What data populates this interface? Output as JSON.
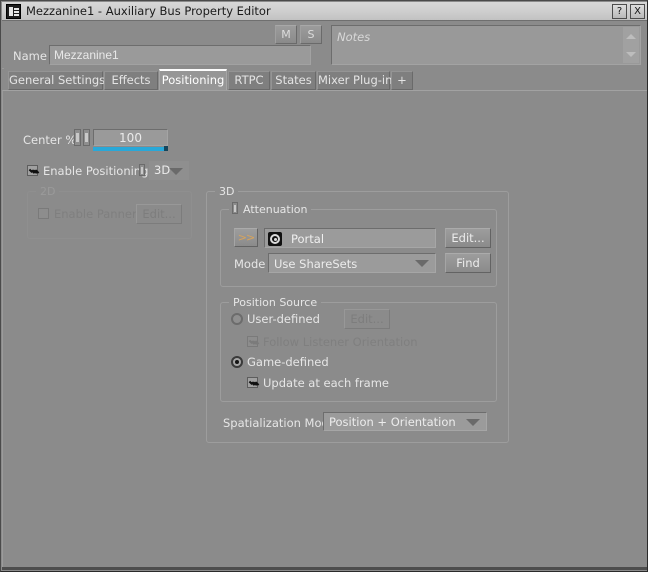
{
  "window": {
    "title": "Mezzanine1 - Auxiliary Bus Property Editor",
    "icon": "wwise-app-icon",
    "help_button": "?",
    "close_button": "X"
  },
  "header": {
    "mute_button": "M",
    "solo_button": "S",
    "name_label": "Name",
    "name_value": "Mezzanine1",
    "notes_placeholder": "Notes"
  },
  "tabs": [
    {
      "label": "General Settings",
      "active": false
    },
    {
      "label": "Effects",
      "active": false
    },
    {
      "label": "Positioning",
      "active": true
    },
    {
      "label": "RTPC",
      "active": false
    },
    {
      "label": "States",
      "active": false
    },
    {
      "label": "Mixer Plug-in",
      "active": false
    },
    {
      "label": "+",
      "active": false
    }
  ],
  "positioning": {
    "center_percent": {
      "label": "Center %",
      "value": "100",
      "fill_ratio": 1.0
    },
    "enable_positioning": {
      "label": "Enable Positioning:",
      "checked": true,
      "mode_value": "3D"
    },
    "group_2d": {
      "title": "2D",
      "enabled": false,
      "enable_panner_label": "Enable Panner",
      "enable_panner_checked": false,
      "edit_button": "Edit..."
    },
    "group_3d": {
      "title": "3D",
      "attenuation": {
        "title": "Attenuation",
        "forward_button": ">>",
        "sharesets_value": "Portal",
        "sharesets_icon": "bullseye-icon",
        "edit_button": "Edit...",
        "mode_label": "Mode",
        "mode_value": "Use ShareSets",
        "find_button": "Find"
      },
      "position_source": {
        "title": "Position Source",
        "user_defined_label": "User-defined",
        "user_defined_selected": false,
        "user_defined_edit_button": "Edit...",
        "follow_listener_label": "Follow Listener Orientation",
        "follow_listener_checked": true,
        "follow_listener_enabled": false,
        "game_defined_label": "Game-defined",
        "game_defined_selected": true,
        "update_each_frame_label": "Update at each frame",
        "update_each_frame_checked": true
      },
      "spatialization": {
        "label": "Spatialization Mode",
        "value": "Position + Orientation"
      }
    }
  },
  "colors": {
    "window_bg": "#8b8b8b",
    "titlebar": "#cfcfcf",
    "accent_slider": "#29a8d8",
    "text": "#e6e6e6",
    "text_disabled": "#7f7f7f",
    "arrow_glyph": "#d8a45c"
  }
}
